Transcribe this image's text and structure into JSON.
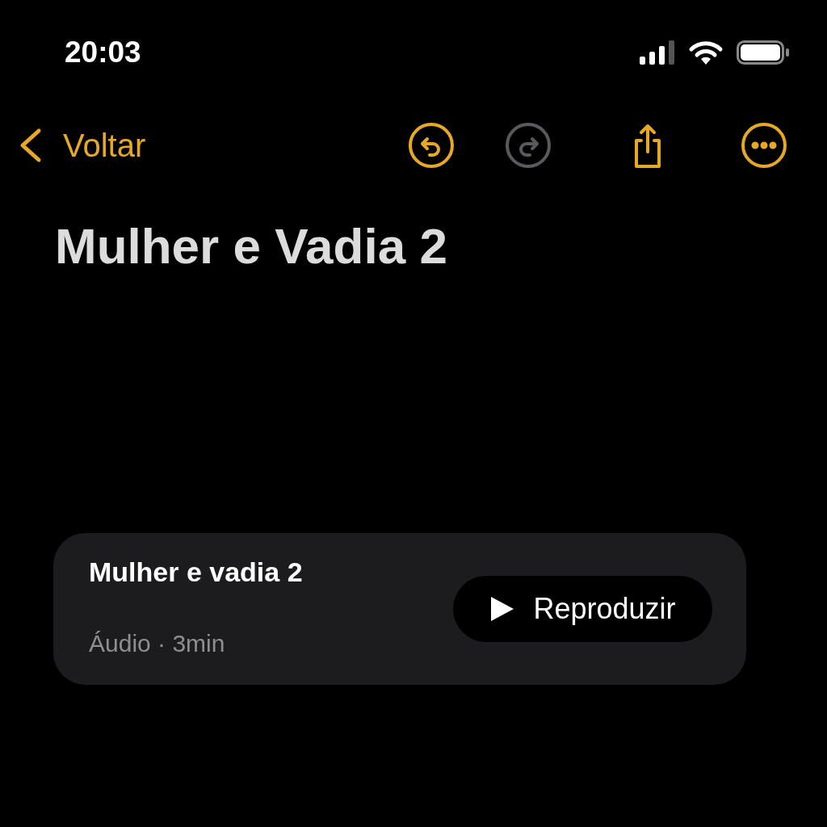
{
  "status_bar": {
    "time": "20:03"
  },
  "nav": {
    "back_label": "Voltar",
    "toolbar": [
      {
        "kind": "undo",
        "disabled": false
      },
      {
        "kind": "redo",
        "disabled": true
      },
      {
        "kind": "share",
        "disabled": false
      },
      {
        "kind": "more",
        "disabled": false
      }
    ]
  },
  "note": {
    "title": "Mulher e Vadia 2",
    "attachment": {
      "title": "Mulher e vadia 2",
      "subtitle": "Áudio · 3min",
      "button": "Reproduzir"
    }
  }
}
